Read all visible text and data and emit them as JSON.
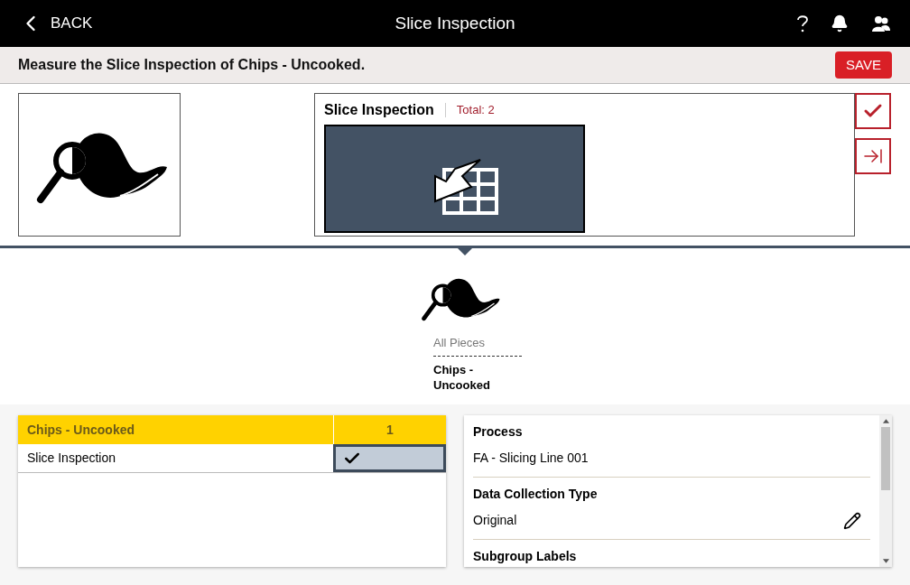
{
  "header": {
    "back_label": "BACK",
    "title": "Slice Inspection"
  },
  "instruction_bar": {
    "text": "Measure the Slice Inspection of Chips - Uncooked.",
    "save_label": "SAVE"
  },
  "inspection_card": {
    "title": "Slice Inspection",
    "total": "Total: 2"
  },
  "piece_selector": {
    "group_label": "All Pieces",
    "piece_label": "Chips - Uncooked"
  },
  "checklist": {
    "header": {
      "name": "Chips - Uncooked",
      "count": "1"
    },
    "rows": [
      {
        "name": "Slice Inspection",
        "checked": true,
        "selected": true
      }
    ]
  },
  "details": [
    {
      "label": "Process",
      "value": "FA - Slicing Line 001",
      "editable": false
    },
    {
      "label": "Data Collection Type",
      "value": "Original",
      "editable": true
    },
    {
      "label": "Subgroup Labels"
    }
  ]
}
